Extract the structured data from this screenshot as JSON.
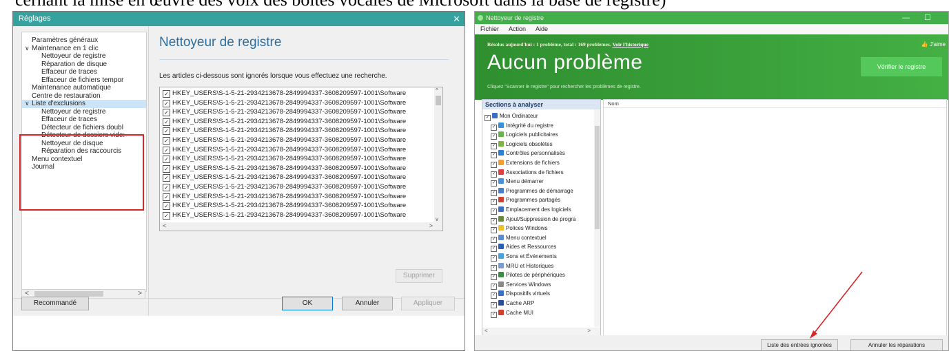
{
  "caption": "cernant la mise en œuvre des voix des boîtes vocales de Microsoft dans la base de registre)",
  "left_window": {
    "title": "Réglages",
    "close_glyph": "✕",
    "tree": [
      {
        "label": "Paramètres généraux",
        "level": 1
      },
      {
        "label": "Maintenance en 1 clic",
        "level": 1,
        "toggle": "∨"
      },
      {
        "label": "Nettoyeur de registre",
        "level": 2
      },
      {
        "label": "Réparation de disque",
        "level": 2
      },
      {
        "label": "Effaceur de traces",
        "level": 2
      },
      {
        "label": "Effaceur de fichiers tempor",
        "level": 2
      },
      {
        "label": "Maintenance automatique",
        "level": 1
      },
      {
        "label": "Centre de restauration",
        "level": 1
      },
      {
        "label": "Liste d'exclusions",
        "level": 1,
        "toggle": "∨",
        "selected": true
      },
      {
        "label": "Nettoyeur de registre",
        "level": 2
      },
      {
        "label": "Effaceur de traces",
        "level": 2
      },
      {
        "label": "Détecteur de fichiers doubl",
        "level": 2
      },
      {
        "label": "Détecteur de dossiers vide:",
        "level": 2
      },
      {
        "label": "Nettoyeur de disque",
        "level": 2
      },
      {
        "label": "Réparation des raccourcis",
        "level": 2
      },
      {
        "label": "Menu contextuel",
        "level": 1
      },
      {
        "label": "Journal",
        "level": 1
      }
    ],
    "tree_scroll_left": "<",
    "tree_scroll_right": ">",
    "panel_title": "Nettoyeur de registre",
    "panel_description": "Les articles ci-dessous sont ignorés lorsque vous effectuez une recherche.",
    "registry_entries": [
      "HKEY_USERS\\S-1-5-21-2934213678-2849994337-3608209597-1001\\Software",
      "HKEY_USERS\\S-1-5-21-2934213678-2849994337-3608209597-1001\\Software",
      "HKEY_USERS\\S-1-5-21-2934213678-2849994337-3608209597-1001\\Software",
      "HKEY_USERS\\S-1-5-21-2934213678-2849994337-3608209597-1001\\Software",
      "HKEY_USERS\\S-1-5-21-2934213678-2849994337-3608209597-1001\\Software",
      "HKEY_USERS\\S-1-5-21-2934213678-2849994337-3608209597-1001\\Software",
      "HKEY_USERS\\S-1-5-21-2934213678-2849994337-3608209597-1001\\Software",
      "HKEY_USERS\\S-1-5-21-2934213678-2849994337-3608209597-1001\\Software",
      "HKEY_USERS\\S-1-5-21-2934213678-2849994337-3608209597-1001\\Software",
      "HKEY_USERS\\S-1-5-21-2934213678-2849994337-3608209597-1001\\Software",
      "HKEY_USERS\\S-1-5-21-2934213678-2849994337-3608209597-1001\\Software",
      "HKEY_USERS\\S-1-5-21-2934213678-2849994337-3608209597-1001\\Software",
      "HKEY_USERS\\S-1-5-21-2934213678-2849994337-3608209597-1001\\Software",
      "HKEY_USERS\\S-1-5-21-2934213678-2849994337-3608209597-1001\\Software"
    ],
    "check_glyph": "✓",
    "list_scroll_left": "<",
    "list_scroll_right": ">",
    "list_scroll_up": "^",
    "list_scroll_down": "v",
    "delete_button": "Supprimer",
    "recommended_button": "Recommandé",
    "ok_button": "OK",
    "cancel_button": "Annuler",
    "apply_button": "Appliquer",
    "colors": {
      "title_bar": "#35a29e",
      "highlight_border": "#d6262b",
      "panel_title": "#2c6e9e"
    }
  },
  "right_window": {
    "title": "Nettoyeur de registre",
    "minimize_glyph": "—",
    "maximize_glyph": "☐",
    "menu": [
      "Fichier",
      "Action",
      "Aide"
    ],
    "status_prefix": "Résolus aujourd'hui : 1 problème, total : 169 problèmes.",
    "history_link": "Voir l'historique",
    "like_label": "J'aime",
    "headline": "Aucun problème",
    "subtitle": "Cliquez \"Scanner le registre\" pour rechercher les problèmes de registre.",
    "verify_button": "Vérifier le registre",
    "sections_header": "Sections à analyser",
    "sections": [
      {
        "label": "Mon Ordinateur",
        "root": true,
        "color": "#3a6fc4"
      },
      {
        "label": "Intégrité du registre",
        "color": "#3a8fd8"
      },
      {
        "label": "Logiciels publicitaires",
        "color": "#6ab04c"
      },
      {
        "label": "Logiciels obsolètes",
        "color": "#7cb342"
      },
      {
        "label": "Contrôles personnalisés",
        "color": "#2d7dd2"
      },
      {
        "label": "Extensions de fichiers",
        "color": "#f0a030"
      },
      {
        "label": "Associations de fichiers",
        "color": "#e04040"
      },
      {
        "label": "Menu démarrer",
        "color": "#4a8fd8"
      },
      {
        "label": "Programmes de démarrage",
        "color": "#4a7fc8"
      },
      {
        "label": "Programmes partagés",
        "color": "#d04030"
      },
      {
        "label": "Emplacement des logiciels",
        "color": "#3a6fc4"
      },
      {
        "label": "Ajout/Suppression de progra",
        "color": "#6a8a3a"
      },
      {
        "label": "Polices Windows",
        "color": "#f0c030"
      },
      {
        "label": "Menu contextuel",
        "color": "#5a8ad0"
      },
      {
        "label": "Aides et Ressources",
        "color": "#2a5fb4"
      },
      {
        "label": "Sons et Événements",
        "color": "#4aa0d8"
      },
      {
        "label": "MRU et Historiques",
        "color": "#7a9ad0"
      },
      {
        "label": "Pilotes de périphériques",
        "color": "#3a8a4a"
      },
      {
        "label": "Services Windows",
        "color": "#8a8a8a"
      },
      {
        "label": "Dispositifs virtuels",
        "color": "#3a6fc4"
      },
      {
        "label": "Cache ARP",
        "color": "#2a4f94"
      },
      {
        "label": "Cache MUI",
        "color": "#d04030"
      }
    ],
    "results_column": "Nom",
    "ignored_entries_button": "Liste des entrées ignorées",
    "undo_repairs_button": "Annuler les réparations",
    "colors": {
      "banner": "#3aa03a",
      "title_bar": "#42b04a",
      "verify_button": "#54c85a",
      "arrow": "#d6262b"
    }
  }
}
